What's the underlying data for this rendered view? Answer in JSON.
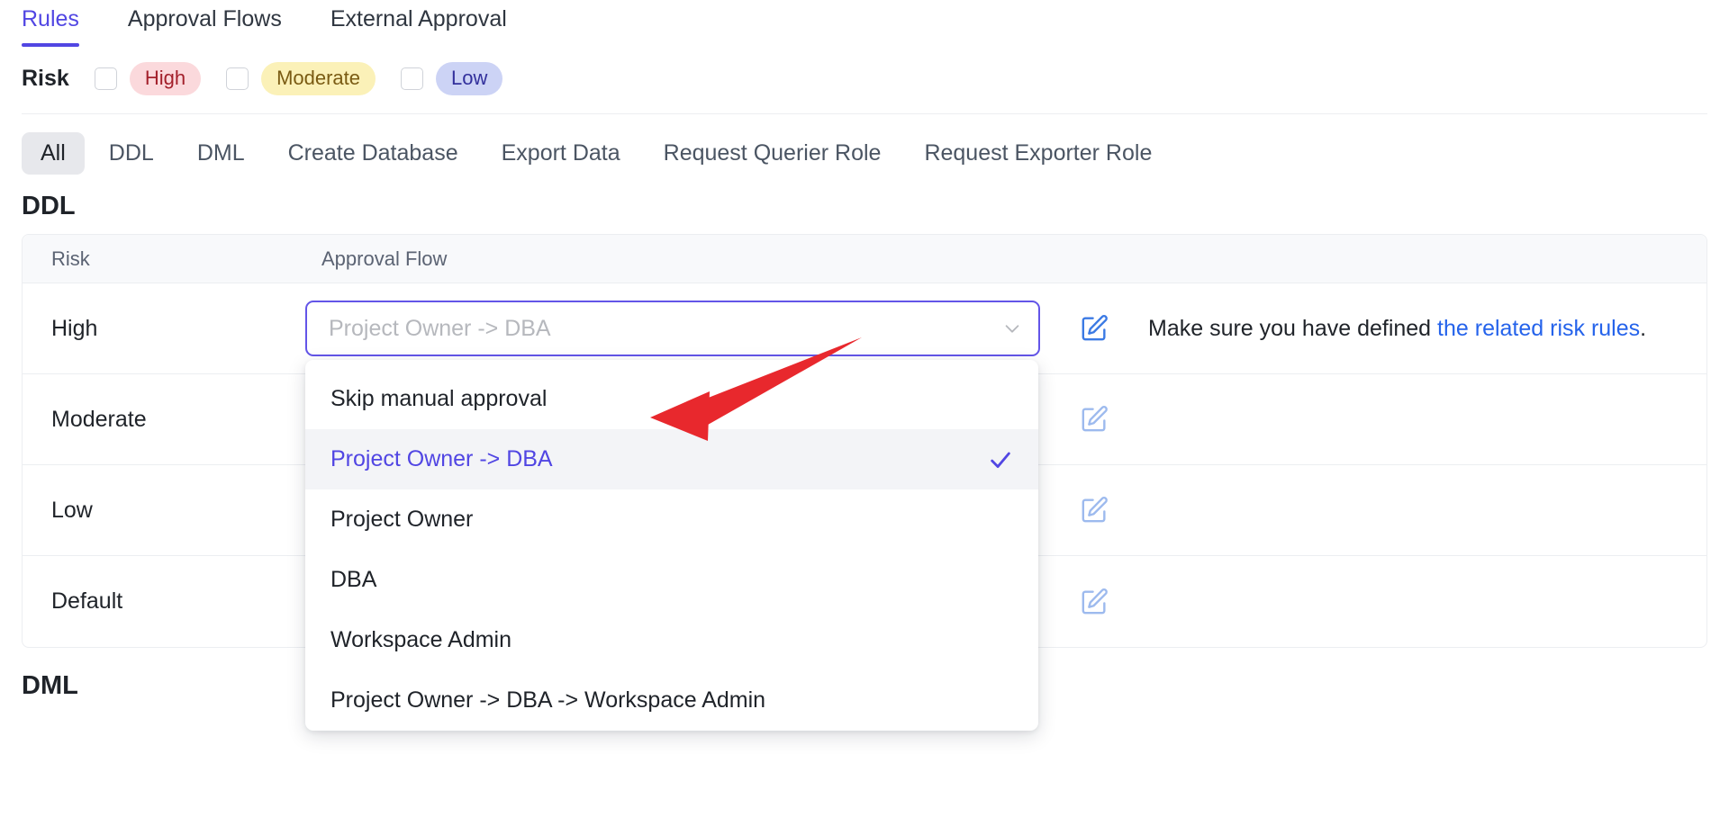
{
  "top_tabs": [
    {
      "label": "Rules",
      "active": true
    },
    {
      "label": "Approval Flows",
      "active": false
    },
    {
      "label": "External Approval",
      "active": false
    }
  ],
  "risk_filter": {
    "label": "Risk",
    "options": [
      {
        "label": "High",
        "checked": false,
        "bg": "#fbd9dc",
        "fg": "#a3202b"
      },
      {
        "label": "Moderate",
        "checked": false,
        "bg": "#fbf1b8",
        "fg": "#7a5b13"
      },
      {
        "label": "Low",
        "checked": false,
        "bg": "#ccd3f5",
        "fg": "#32309c"
      }
    ]
  },
  "category_tabs": [
    {
      "label": "All",
      "active": true
    },
    {
      "label": "DDL",
      "active": false
    },
    {
      "label": "DML",
      "active": false
    },
    {
      "label": "Create Database",
      "active": false
    },
    {
      "label": "Export Data",
      "active": false
    },
    {
      "label": "Request Querier Role",
      "active": false
    },
    {
      "label": "Request Exporter Role",
      "active": false
    }
  ],
  "ddl_section": {
    "title": "DDL",
    "columns": {
      "risk": "Risk",
      "flow": "Approval Flow"
    },
    "rows": [
      {
        "risk": "High",
        "flow_value": "Project Owner -> DBA",
        "hint_prefix": "Make sure you have defined ",
        "hint_link": "the related risk rules",
        "hint_suffix": ".",
        "edit_icon": "pencil-square-icon"
      },
      {
        "risk": "Moderate",
        "edit_icon": "pencil-square-icon"
      },
      {
        "risk": "Low",
        "edit_icon": "pencil-square-icon"
      },
      {
        "risk": "Default",
        "edit_icon": "pencil-square-icon"
      }
    ]
  },
  "dropdown": {
    "open": true,
    "selected": "Project Owner -> DBA",
    "options": [
      {
        "label": "Skip manual approval",
        "selected": false
      },
      {
        "label": "Project Owner -> DBA",
        "selected": true
      },
      {
        "label": "Project Owner",
        "selected": false
      },
      {
        "label": "DBA",
        "selected": false
      },
      {
        "label": "Workspace Admin",
        "selected": false
      },
      {
        "label": "Project Owner -> DBA -> Workspace Admin",
        "selected": false
      }
    ]
  },
  "dml_section": {
    "title": "DML"
  },
  "annotation": {
    "type": "arrow",
    "color": "#e8282d"
  },
  "colors": {
    "accent": "#5146e3",
    "select_border": "#6355e8",
    "link": "#2563eb",
    "edit_icon": "#3b7ae4",
    "edit_icon_muted": "#9dbaee",
    "row_border": "#eceef1",
    "header_bg": "#f8f9fb",
    "option_hover_bg": "#f3f4f7"
  }
}
